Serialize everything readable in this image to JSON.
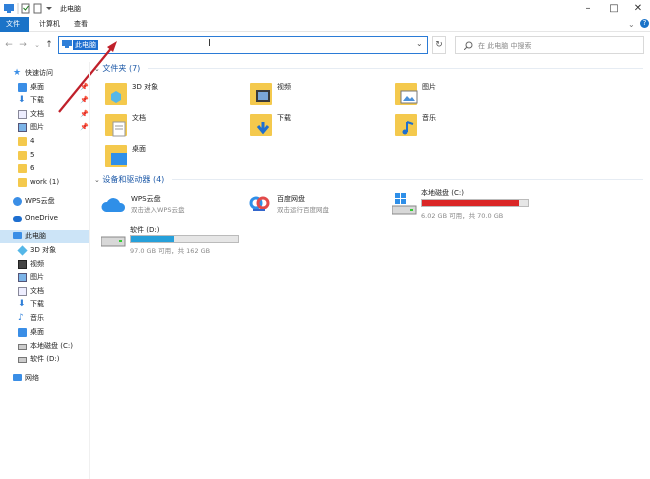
{
  "window": {
    "title": "此电脑"
  },
  "ribbon": {
    "tabs": [
      {
        "label": "文件"
      },
      {
        "label": "计算机"
      },
      {
        "label": "查看"
      }
    ]
  },
  "address": {
    "value": "此电脑",
    "search_placeholder": "在 此电脑 中搜索"
  },
  "sidebar": {
    "quick_access": "快速访问",
    "quick_items": [
      {
        "label": "桌面",
        "pinned": true
      },
      {
        "label": "下载",
        "pinned": true
      },
      {
        "label": "文档",
        "pinned": true
      },
      {
        "label": "图片",
        "pinned": true
      },
      {
        "label": "4"
      },
      {
        "label": "5"
      },
      {
        "label": "6"
      },
      {
        "label": "work (1)"
      }
    ],
    "wps": "WPS云盘",
    "onedrive": "OneDrive",
    "this_pc": "此电脑",
    "pc_items": [
      {
        "label": "3D 对象"
      },
      {
        "label": "视频"
      },
      {
        "label": "图片"
      },
      {
        "label": "文档"
      },
      {
        "label": "下载"
      },
      {
        "label": "音乐"
      },
      {
        "label": "桌面"
      },
      {
        "label": "本地磁盘 (C:)"
      },
      {
        "label": "软件 (D:)"
      }
    ],
    "network": "网络"
  },
  "main": {
    "folders_header": "文件夹 (7)",
    "folders": [
      {
        "label": "3D 对象"
      },
      {
        "label": "视频"
      },
      {
        "label": "图片"
      },
      {
        "label": "文档"
      },
      {
        "label": "下载"
      },
      {
        "label": "音乐"
      },
      {
        "label": "桌面"
      }
    ],
    "devices_header": "设备和驱动器 (4)",
    "devices": {
      "wps": {
        "name": "WPS云盘",
        "desc": "双击进入WPS云盘"
      },
      "baidu": {
        "name": "百度网盘",
        "desc": "双击运行百度网盘"
      },
      "c": {
        "name": "本地磁盘 (C:)",
        "space": "6.02 GB 可用，共 70.0 GB",
        "used_fraction": 0.914,
        "bar_color": "#da2626"
      },
      "d": {
        "name": "软件 (D:)",
        "space": "97.0 GB 可用，共 162 GB",
        "used_fraction": 0.401,
        "bar_color": "#26a0da"
      }
    }
  },
  "colors": {
    "accent": "#1a73c8",
    "arrow": "#c0202a"
  }
}
